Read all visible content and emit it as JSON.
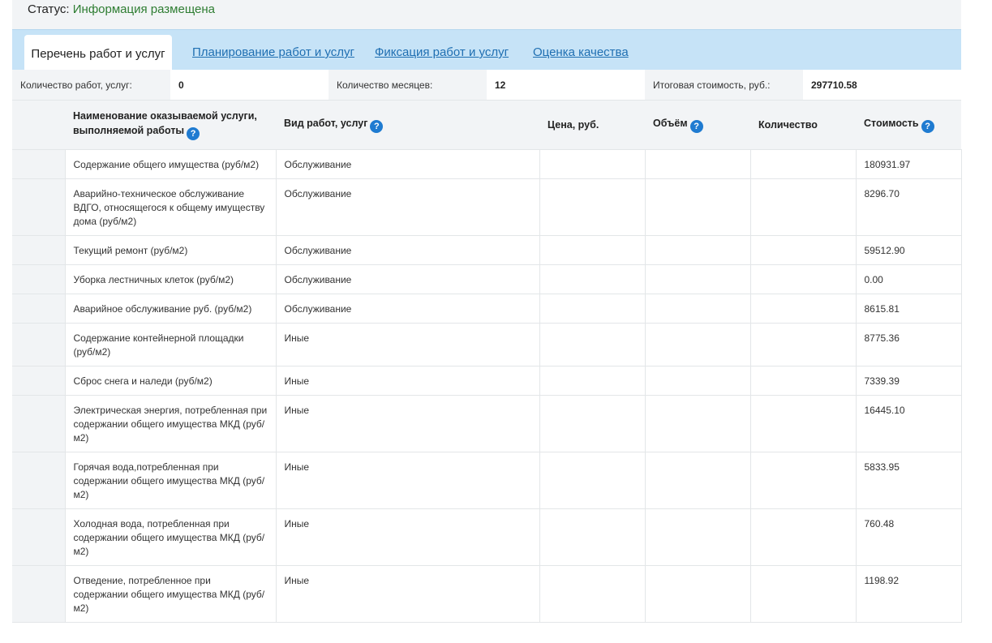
{
  "status": {
    "label": "Статус:",
    "value": "Информация размещена"
  },
  "tabs": {
    "active": "Перечень работ и услуг",
    "links": [
      "Планирование работ и услуг",
      "Фиксация работ и услуг",
      "Оценка качества"
    ]
  },
  "summary": {
    "works_count_label": "Количество работ, услуг:",
    "works_count_value": "0",
    "months_label": "Количество месяцев:",
    "months_value": "12",
    "total_label": "Итоговая стоимость, руб.:",
    "total_value": "297710.58"
  },
  "table": {
    "headers": {
      "name": "Наименование оказываемой услуги, выполняемой работы",
      "type": "Вид работ, услуг",
      "price": "Цена, руб.",
      "volume": "Объём",
      "quantity": "Количество",
      "cost": "Стоимость"
    },
    "rows": [
      {
        "name": "Содержание общего имущества (руб/м2)",
        "type": "Обслуживание",
        "cost": "180931.97"
      },
      {
        "name": "Аварийно-техническое обслуживание ВДГО, относящегося к общему имуществу дома (руб/м2)",
        "type": "Обслуживание",
        "cost": "8296.70"
      },
      {
        "name": "Текущий ремонт (руб/м2)",
        "type": "Обслуживание",
        "cost": "59512.90"
      },
      {
        "name": "Уборка лестничных клеток (руб/м2)",
        "type": "Обслуживание",
        "cost": "0.00"
      },
      {
        "name": "Аварийное обслуживание руб. (руб/м2)",
        "type": "Обслуживание",
        "cost": "8615.81"
      },
      {
        "name": "Содержание контейнерной площадки (руб/м2)",
        "type": "Иные",
        "cost": "8775.36"
      },
      {
        "name": "Сброс снега и наледи (руб/м2)",
        "type": "Иные",
        "cost": "7339.39"
      },
      {
        "name": "Электрическая энергия, потребленная при содержании общего имущества МКД (руб/м2)",
        "type": "Иные",
        "cost": "16445.10"
      },
      {
        "name": "Горячая вода,потребленная при содержании общего имущества МКД (руб/м2)",
        "type": "Иные",
        "cost": "5833.95"
      },
      {
        "name": "Холодная вода, потребленная при содержании общего имущества МКД (руб/м2)",
        "type": "Иные",
        "cost": "760.48"
      },
      {
        "name": "Отведение, потребленное при содержании общего имущества МКД (руб/м2)",
        "type": "Иные",
        "cost": "1198.92"
      }
    ]
  },
  "colors": {
    "status_green": "#2e7d32",
    "tab_bar": "#c6e3f7",
    "link_blue": "#1f6fb2",
    "help_icon": "#1f7bd1"
  },
  "icons": {
    "help": "question-circle-icon"
  }
}
